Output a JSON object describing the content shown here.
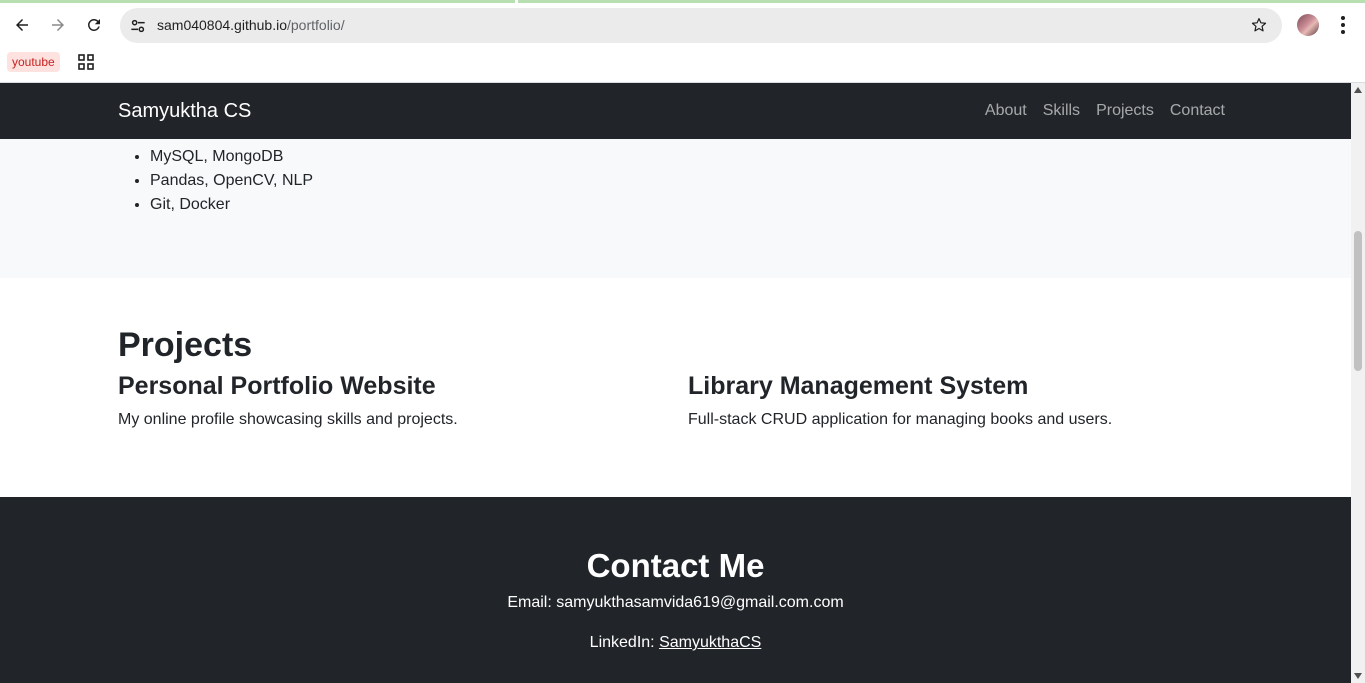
{
  "browser": {
    "url_host": "sam040804.github.io",
    "url_path": "/portfolio/",
    "bookmarks": [
      {
        "label": "youtube"
      }
    ]
  },
  "navbar": {
    "brand": "Samyuktha CS",
    "links": [
      "About",
      "Skills",
      "Projects",
      "Contact"
    ]
  },
  "skills": {
    "items": [
      "MySQL, MongoDB",
      "Pandas, OpenCV, NLP",
      "Git, Docker"
    ]
  },
  "projects": {
    "title": "Projects",
    "items": [
      {
        "name": "Personal Portfolio Website",
        "description": "My online profile showcasing skills and projects."
      },
      {
        "name": "Library Management System",
        "description": "Full-stack CRUD application for managing books and users."
      }
    ]
  },
  "contact": {
    "title": "Contact Me",
    "email_label": "Email:",
    "email": "samyukthasamvida619@gmail.com.com",
    "linkedin_label": "LinkedIn:",
    "linkedin": "SamyukthaCS"
  },
  "colors": {
    "dark": "#212529",
    "light_section": "#f8f9fa",
    "nav_link": "rgba(255,255,255,0.6)"
  }
}
